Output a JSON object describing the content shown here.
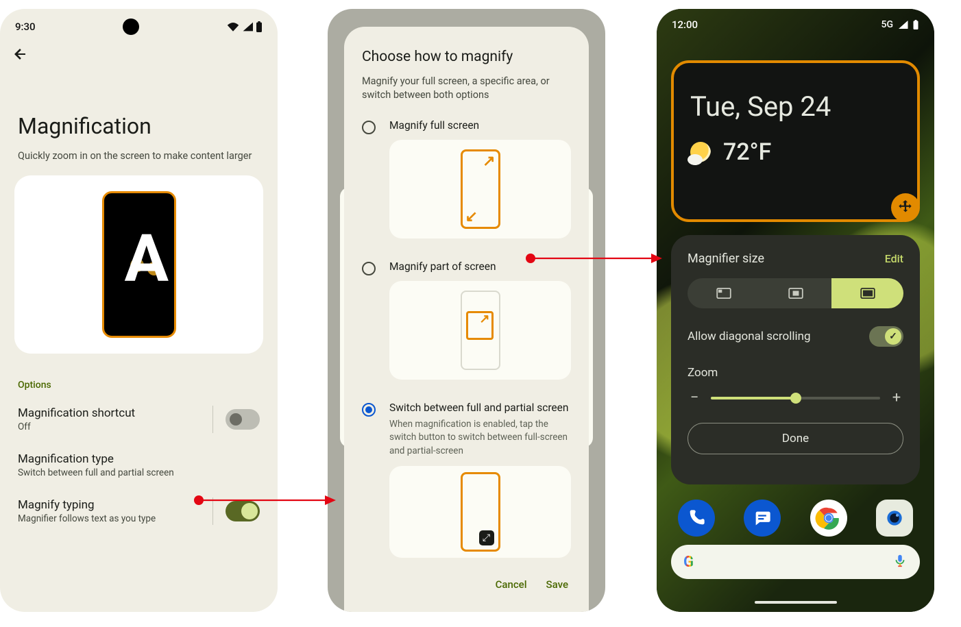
{
  "phone1": {
    "status_time": "9:30",
    "title": "Magnification",
    "subtitle": "Quickly zoom in on the screen to make content larger",
    "options_header": "Options",
    "rows": {
      "shortcut": {
        "primary": "Magnification shortcut",
        "secondary": "Off",
        "on": false
      },
      "type": {
        "primary": "Magnification type",
        "secondary": "Switch between full and partial screen"
      },
      "typing": {
        "primary": "Magnify typing",
        "secondary": "Magnifier follows text as you type",
        "on": true
      }
    }
  },
  "phone2": {
    "dialog_title": "Choose how to magnify",
    "dialog_subtitle": "Magnify your full screen, a specific area, or switch between both options",
    "options": {
      "full": {
        "label": "Magnify full screen"
      },
      "part": {
        "label": "Magnify part of screen"
      },
      "switch": {
        "label": "Switch between full and partial screen",
        "desc": "When magnification is enabled, tap the switch button to switch between full-screen and partial-screen"
      }
    },
    "actions": {
      "cancel": "Cancel",
      "save": "Save"
    }
  },
  "phone3": {
    "status_time": "12:00",
    "status_net": "5G",
    "lens": {
      "date": "Tue, Sep 24",
      "temp": "72°F"
    },
    "panel": {
      "title": "Magnifier size",
      "edit": "Edit",
      "diagonal_label": "Allow diagonal scrolling",
      "diagonal_on": true,
      "zoom_label": "Zoom",
      "done": "Done"
    }
  }
}
